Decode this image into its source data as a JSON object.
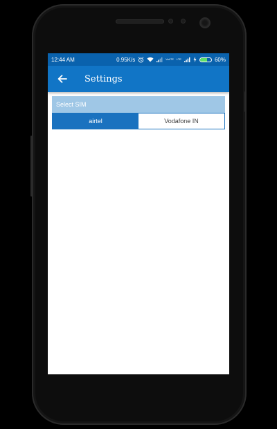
{
  "status_bar": {
    "time": "12:44 AM",
    "speed": "0.95K/s",
    "sim1_label": "VoLTE",
    "sim2_label": "LTE",
    "battery_percent": "60%",
    "battery_level": 0.6,
    "icons": [
      "alarm-icon",
      "wifi-icon",
      "signal-icon",
      "signal-icon",
      "charging-icon",
      "battery-icon"
    ]
  },
  "toolbar": {
    "back_icon": "arrow-left-icon",
    "title": "Settings"
  },
  "select_sim": {
    "header": "Select SIM",
    "options": [
      {
        "label": "airtel",
        "selected": true
      },
      {
        "label": "Vodafone IN",
        "selected": false
      }
    ]
  },
  "colors": {
    "status_bar": "#0a62ad",
    "toolbar": "#1175c6",
    "section_header": "#9fc7e6",
    "selected_tab": "#1a72bf",
    "battery_fill": "#5fe06a"
  }
}
